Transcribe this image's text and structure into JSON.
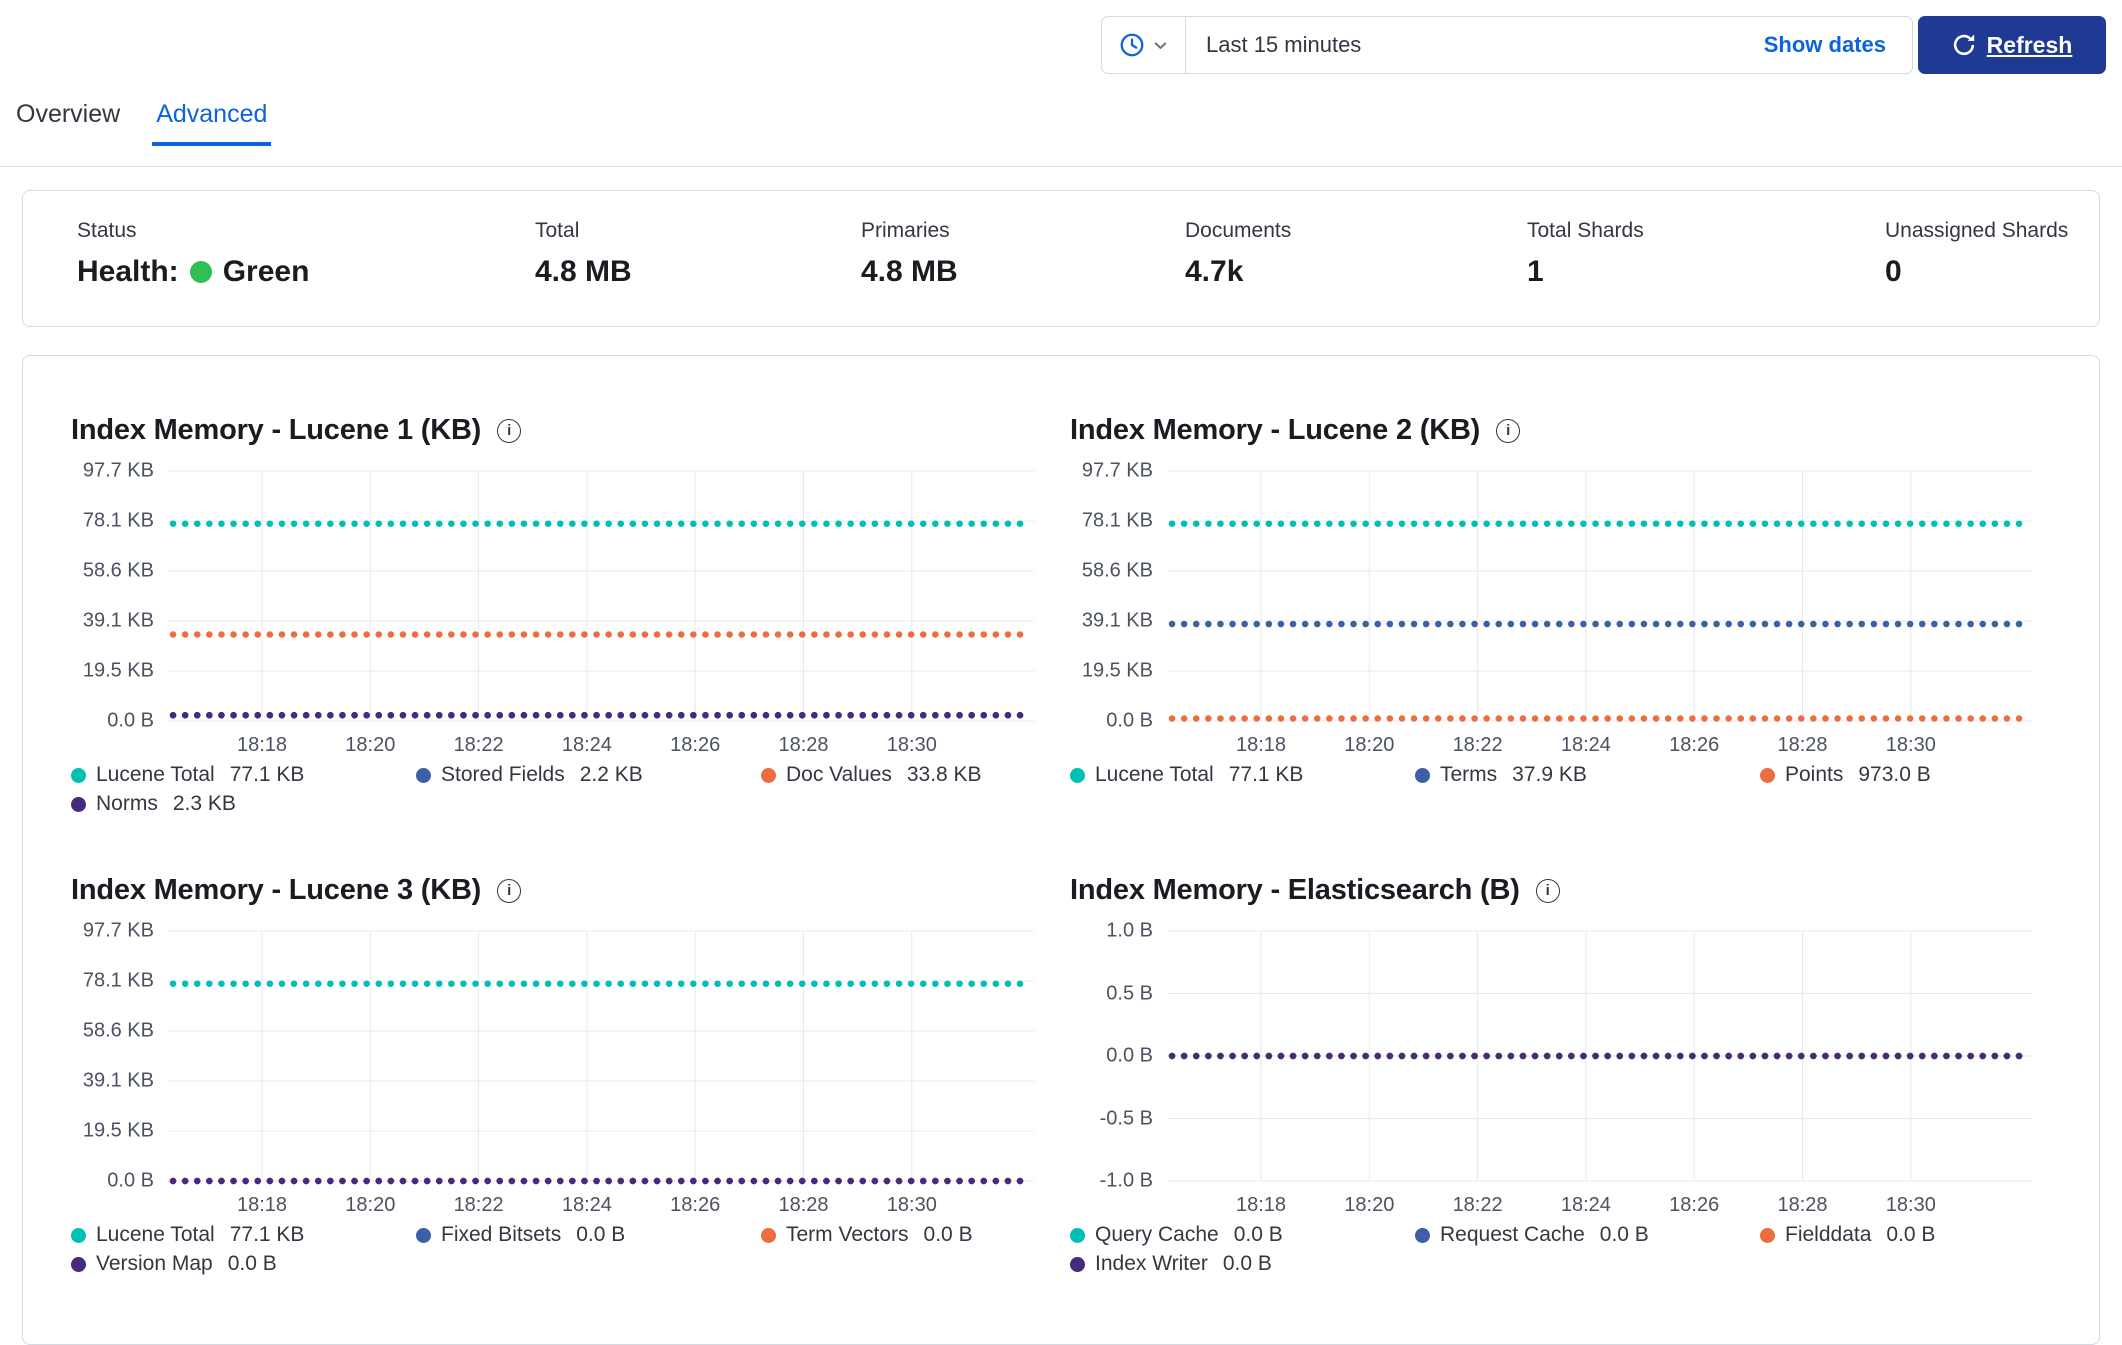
{
  "toolbar": {
    "time_range": "Last 15 minutes",
    "show_dates_label": "Show dates",
    "refresh_label": "Refresh"
  },
  "tabs": [
    {
      "label": "Overview",
      "active": false
    },
    {
      "label": "Advanced",
      "active": true
    }
  ],
  "summary": {
    "stats": [
      {
        "label": "Status",
        "prefix": "Health:",
        "health": "Green"
      },
      {
        "label": "Total",
        "value": "4.8 MB"
      },
      {
        "label": "Primaries",
        "value": "4.8 MB"
      },
      {
        "label": "Documents",
        "value": "4.7k"
      },
      {
        "label": "Total Shards",
        "value": "1"
      },
      {
        "label": "Unassigned Shards",
        "value": "0"
      }
    ]
  },
  "colors": {
    "accent": "#0b64dd",
    "refresh_button_bg": "#1f3a93",
    "health_green": "#2fbf53",
    "panel_border": "#d3dae6",
    "grid_line": "#e6eaf0",
    "axis_text": "#4c5260",
    "text": "#343741",
    "heading": "#1a1c21",
    "teal": "#00bfb3",
    "blue": "#3d5fa8",
    "orange": "#ec6e40",
    "purple": "#472a7c"
  },
  "chart_data": [
    {
      "type": "line",
      "title": "Index Memory - Lucene 1 (KB)",
      "y_min": 0,
      "y_max": 97.7,
      "y_ticks": [
        {
          "label": "97.7 KB",
          "value": 97.7
        },
        {
          "label": "78.1 KB",
          "value": 78.1
        },
        {
          "label": "58.6 KB",
          "value": 58.6
        },
        {
          "label": "39.1 KB",
          "value": 39.1
        },
        {
          "label": "19.5 KB",
          "value": 19.5
        },
        {
          "label": "0.0 B",
          "value": 0
        }
      ],
      "x_ticks": [
        "18:18",
        "18:20",
        "18:22",
        "18:24",
        "18:26",
        "18:28",
        "18:30"
      ],
      "series": [
        {
          "name": "Lucene Total",
          "value": 77.1,
          "value_label": "77.1 KB",
          "color_key": "teal"
        },
        {
          "name": "Stored Fields",
          "value": 2.2,
          "value_label": "2.2 KB",
          "color_key": "blue"
        },
        {
          "name": "Doc Values",
          "value": 33.8,
          "value_label": "33.8 KB",
          "color_key": "orange"
        },
        {
          "name": "Norms",
          "value": 2.3,
          "value_label": "2.3 KB",
          "color_key": "purple"
        }
      ]
    },
    {
      "type": "line",
      "title": "Index Memory - Lucene 2 (KB)",
      "y_min": 0,
      "y_max": 97.7,
      "y_ticks": [
        {
          "label": "97.7 KB",
          "value": 97.7
        },
        {
          "label": "78.1 KB",
          "value": 78.1
        },
        {
          "label": "58.6 KB",
          "value": 58.6
        },
        {
          "label": "39.1 KB",
          "value": 39.1
        },
        {
          "label": "19.5 KB",
          "value": 19.5
        },
        {
          "label": "0.0 B",
          "value": 0
        }
      ],
      "x_ticks": [
        "18:18",
        "18:20",
        "18:22",
        "18:24",
        "18:26",
        "18:28",
        "18:30"
      ],
      "series": [
        {
          "name": "Lucene Total",
          "value": 77.1,
          "value_label": "77.1 KB",
          "color_key": "teal"
        },
        {
          "name": "Terms",
          "value": 37.9,
          "value_label": "37.9 KB",
          "color_key": "blue"
        },
        {
          "name": "Points",
          "value": 0.973,
          "value_label": "973.0 B",
          "color_key": "orange"
        }
      ]
    },
    {
      "type": "line",
      "title": "Index Memory - Lucene 3 (KB)",
      "y_min": 0,
      "y_max": 97.7,
      "y_ticks": [
        {
          "label": "97.7 KB",
          "value": 97.7
        },
        {
          "label": "78.1 KB",
          "value": 78.1
        },
        {
          "label": "58.6 KB",
          "value": 58.6
        },
        {
          "label": "39.1 KB",
          "value": 39.1
        },
        {
          "label": "19.5 KB",
          "value": 19.5
        },
        {
          "label": "0.0 B",
          "value": 0
        }
      ],
      "x_ticks": [
        "18:18",
        "18:20",
        "18:22",
        "18:24",
        "18:26",
        "18:28",
        "18:30"
      ],
      "series": [
        {
          "name": "Lucene Total",
          "value": 77.1,
          "value_label": "77.1 KB",
          "color_key": "teal"
        },
        {
          "name": "Fixed Bitsets",
          "value": 0,
          "value_label": "0.0 B",
          "color_key": "blue"
        },
        {
          "name": "Term Vectors",
          "value": 0,
          "value_label": "0.0 B",
          "color_key": "orange"
        },
        {
          "name": "Version Map",
          "value": 0,
          "value_label": "0.0 B",
          "color_key": "purple"
        }
      ]
    },
    {
      "type": "line",
      "title": "Index Memory - Elasticsearch (B)",
      "y_min": -1,
      "y_max": 1,
      "y_ticks": [
        {
          "label": "1.0 B",
          "value": 1
        },
        {
          "label": "0.5 B",
          "value": 0.5
        },
        {
          "label": "0.0 B",
          "value": 0
        },
        {
          "label": "-0.5 B",
          "value": -0.5
        },
        {
          "label": "-1.0 B",
          "value": -1
        }
      ],
      "x_ticks": [
        "18:18",
        "18:20",
        "18:22",
        "18:24",
        "18:26",
        "18:28",
        "18:30"
      ],
      "series": [
        {
          "name": "Query Cache",
          "value": 0,
          "value_label": "0.0 B",
          "color_key": "teal"
        },
        {
          "name": "Request Cache",
          "value": 0,
          "value_label": "0.0 B",
          "color_key": "blue"
        },
        {
          "name": "Fielddata",
          "value": 0,
          "value_label": "0.0 B",
          "color_key": "orange"
        },
        {
          "name": "Index Writer",
          "value": 0,
          "value_label": "0.0 B",
          "color_key": "purple"
        }
      ]
    }
  ]
}
